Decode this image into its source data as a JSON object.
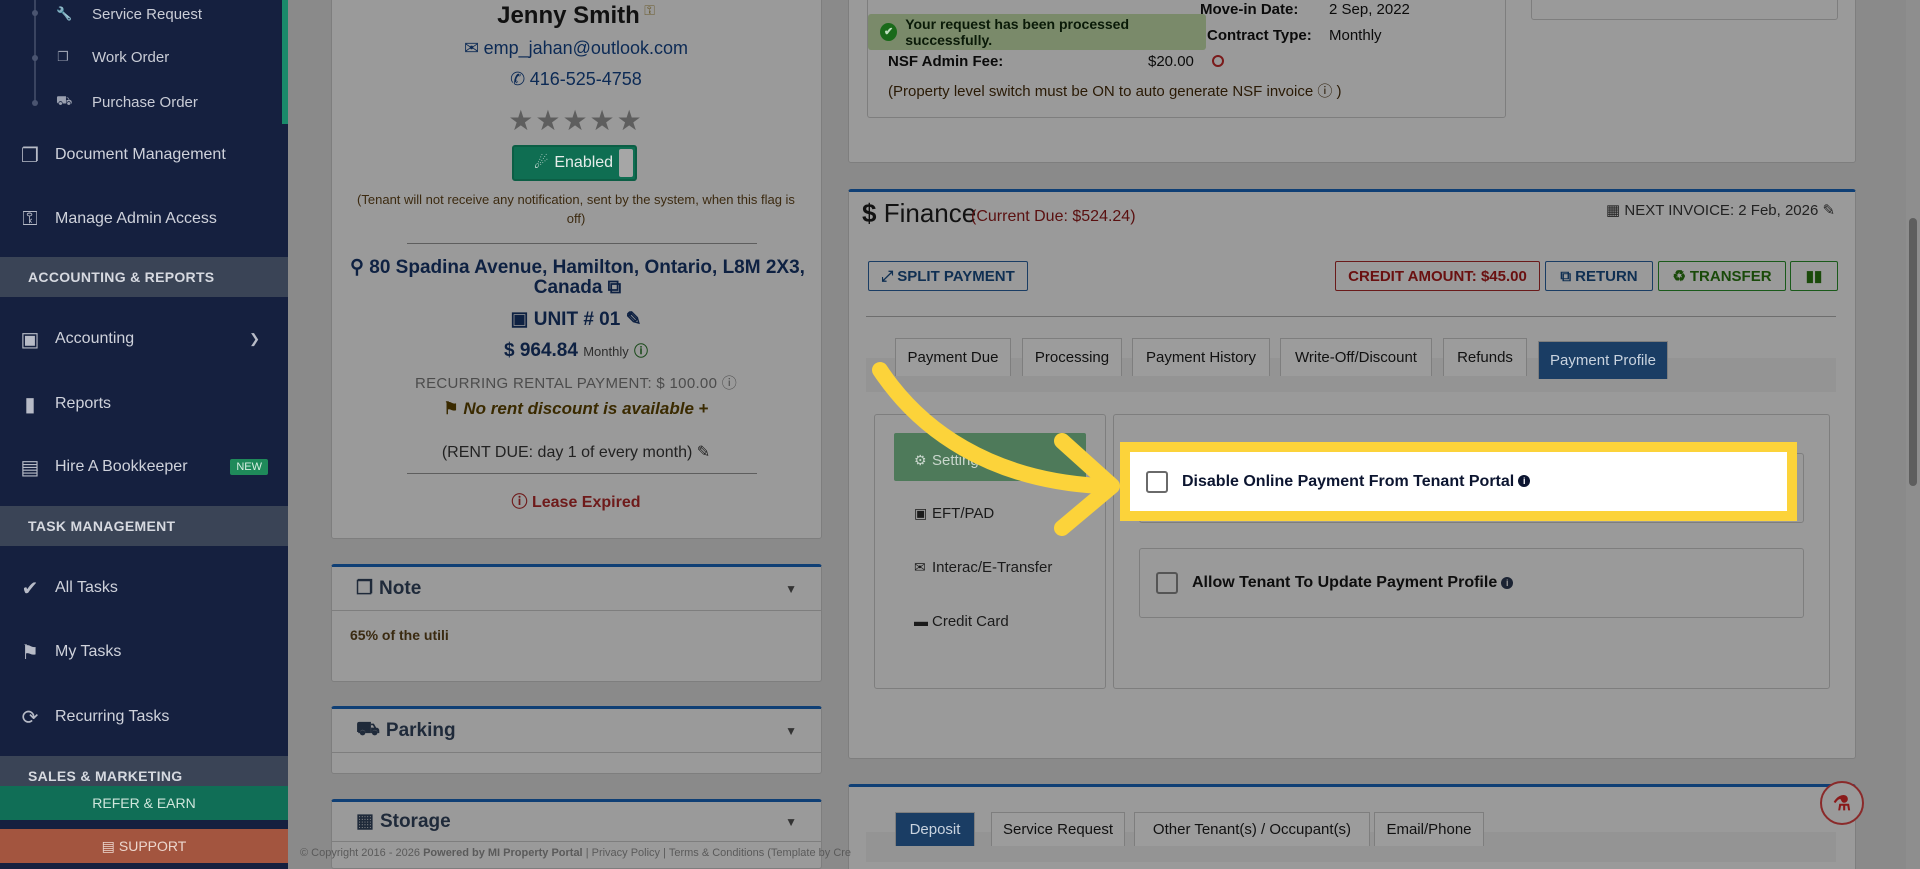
{
  "sidebar": {
    "sub_items": [
      {
        "label": "Service Request",
        "icon": "wrench-icon"
      },
      {
        "label": "Work Order",
        "icon": "copy-icon"
      },
      {
        "label": "Purchase Order",
        "icon": "truck-icon"
      }
    ],
    "items": [
      {
        "label": "Document Management",
        "icon": "documents-icon"
      },
      {
        "label": "Manage Admin Access",
        "icon": "key-icon"
      },
      {
        "label": "Accounting",
        "icon": "money-icon"
      },
      {
        "label": "Reports",
        "icon": "bar-chart-icon"
      },
      {
        "label": "Hire A Bookkeeper",
        "icon": "book-icon",
        "badge": "NEW"
      },
      {
        "label": "All Tasks",
        "icon": "check-icon"
      },
      {
        "label": "My Tasks",
        "icon": "tag-icon"
      },
      {
        "label": "Recurring Tasks",
        "icon": "refresh-icon"
      }
    ],
    "sections": {
      "accounting": "ACCOUNTING & REPORTS",
      "tasks": "TASK MANAGEMENT",
      "sales": "SALES & MARKETING"
    },
    "refer_label": "REFER & EARN",
    "support_label": "SUPPORT"
  },
  "tenant": {
    "name": "Jenny Smith",
    "email": "emp_jahan@outlook.com",
    "phone": "416-525-4758",
    "toggle_label": "Enabled",
    "notify_note": "(Tenant will not receive any notification, sent by the system, when this flag is off)",
    "address": "80 Spadina Avenue, Hamilton, Ontario, L8M 2X3, Canada",
    "unit": "UNIT # 01",
    "rent": "$ 964.84",
    "rent_period": "Monthly",
    "recurring": "RECURRING RENTAL PAYMENT: $ 100.00",
    "no_discount": "No rent discount is available",
    "rent_due": "(RENT DUE: day 1 of every month)",
    "lease_status": "Lease Expired"
  },
  "panels": {
    "note_title": "Note",
    "note_text": "65% of the utili",
    "parking_title": "Parking",
    "storage_title": "Storage"
  },
  "lease": {
    "move_in_label": "Move-in Date:",
    "move_in_value": "2 Sep, 2022",
    "contract_label": "Contract Type:",
    "contract_value": "Monthly",
    "nsf_label": "NSF Admin Fee:",
    "nsf_value": "$20.00",
    "nsf_note": "(Property level switch must be ON to auto generate NSF invoice"
  },
  "toast": {
    "message": "Your request has been processed successfully."
  },
  "finance": {
    "title": "Finance",
    "currency": "$",
    "current_due": "(Current Due: $524.24)",
    "next_invoice": "NEXT INVOICE: 2 Feb, 2026",
    "split_payment": "SPLIT PAYMENT",
    "credit_amount": "CREDIT AMOUNT: $45.00",
    "return": "RETURN",
    "transfer": "TRANSFER",
    "tabs": [
      "Payment Due",
      "Processing",
      "Payment History",
      "Write-Off/Discount",
      "Refunds",
      "Payment Profile"
    ],
    "methods": [
      "Settings",
      "EFT/PAD",
      "Interac/E-Transfer",
      "Credit Card"
    ],
    "options": [
      "Disable Online Payment From Tenant Portal",
      "Allow Tenant To Update Payment Profile"
    ]
  },
  "bottom_tabs": [
    "Deposit",
    "Service Request",
    "Other Tenant(s) / Occupant(s)",
    "Email/Phone"
  ],
  "footer": {
    "copyright": "© Copyright 2016 - 2026",
    "powered": "Powered by MI Property Portal",
    "links": "| Privacy Policy | Terms & Conditions",
    "template": "(Template by",
    "template_trail": "Cre"
  },
  "colors": {
    "highlight": "#fcd33a",
    "primary": "#1a3d64",
    "sidebar": "#15203f"
  }
}
